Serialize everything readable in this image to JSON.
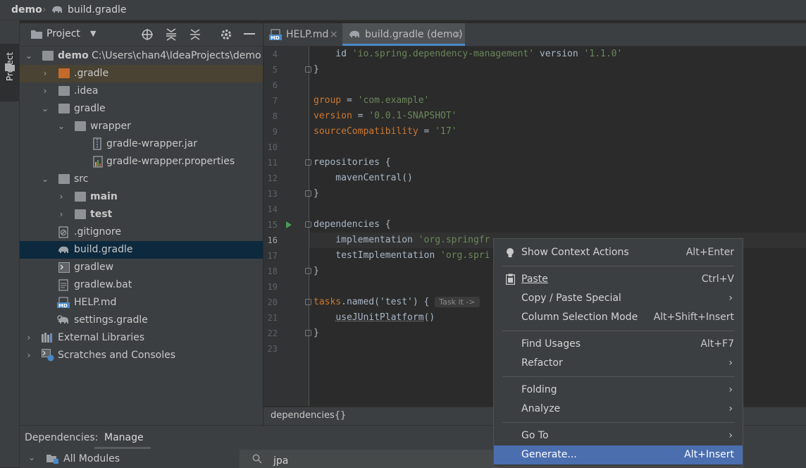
{
  "breadcrumb": {
    "project": "demo",
    "file": "build.gradle"
  },
  "sidebar": {
    "label": "Project"
  },
  "project_panel": {
    "title": "Project",
    "tree": [
      {
        "label": "demo",
        "hint": "C:\\Users\\chan4\\IdeaProjects\\demo",
        "bold": true
      },
      {
        "label": ".gradle"
      },
      {
        "label": ".idea"
      },
      {
        "label": "gradle"
      },
      {
        "label": "wrapper"
      },
      {
        "label": "gradle-wrapper.jar"
      },
      {
        "label": "gradle-wrapper.properties"
      },
      {
        "label": "src"
      },
      {
        "label": "main",
        "bold": true
      },
      {
        "label": "test",
        "bold": true
      },
      {
        "label": ".gitignore"
      },
      {
        "label": "build.gradle",
        "selected": true
      },
      {
        "label": "gradlew"
      },
      {
        "label": "gradlew.bat"
      },
      {
        "label": "HELP.md"
      },
      {
        "label": "settings.gradle"
      },
      {
        "label": "External Libraries"
      },
      {
        "label": "Scratches and Consoles"
      }
    ]
  },
  "editor": {
    "tabs": [
      {
        "label": "HELP.md"
      },
      {
        "label": "build.gradle (demo)",
        "active": true
      }
    ],
    "lines": [
      {
        "n": "4",
        "text": ""
      },
      {
        "n": "5",
        "text": "}"
      },
      {
        "n": "6",
        "text": ""
      },
      {
        "n": "7",
        "text": ""
      },
      {
        "n": "8",
        "text": ""
      },
      {
        "n": "9",
        "text": ""
      },
      {
        "n": "10",
        "text": ""
      },
      {
        "n": "11",
        "text": "repositories {"
      },
      {
        "n": "12",
        "text": "    mavenCentral()"
      },
      {
        "n": "13",
        "text": "}"
      },
      {
        "n": "14",
        "text": ""
      },
      {
        "n": "15",
        "text": "dependencies {"
      },
      {
        "n": "16",
        "text": ""
      },
      {
        "n": "17",
        "text": ""
      },
      {
        "n": "18",
        "text": "}"
      },
      {
        "n": "19",
        "text": ""
      },
      {
        "n": "20",
        "text": ""
      },
      {
        "n": "21",
        "text": ""
      },
      {
        "n": "22",
        "text": "}"
      },
      {
        "n": "23",
        "text": ""
      }
    ],
    "code": {
      "l4_pre": "    id ",
      "l4_str": "'io.spring.dependency-management'",
      "l4_mid": " version ",
      "l4_ver": "'1.1.0'",
      "l7_kw": "group",
      "l7_eq": " = ",
      "l7_str": "'com.example'",
      "l8_kw": "version",
      "l8_eq": " = ",
      "l8_str": "'0.0.1-SNAPSHOT'",
      "l9_kw": "sourceCompatibility",
      "l9_eq": " = ",
      "l9_str": "'17'",
      "l16_pre": "    implementation ",
      "l16_str": "'org.springfr",
      "l17_pre": "    testImplementation ",
      "l17_str": "'org.spri",
      "l20_kw": "tasks",
      "l20_rest": ".named('test') {",
      "l20_hint": "Task it ->",
      "l21_pre": "    ",
      "l21_fn": "useJUnitPlatform",
      "l21_rest": "()"
    },
    "breadcrumb": "dependencies{}"
  },
  "bottom_panel": {
    "tab_label": "Dependencies:",
    "tab_manage": "Manage",
    "modules": "All Modules",
    "search_value": "jpa"
  },
  "context_menu": {
    "items": [
      {
        "label": "Show Context Actions",
        "shortcut": "Alt+Enter"
      },
      {
        "label": "Paste",
        "shortcut": "Ctrl+V"
      },
      {
        "label": "Copy / Paste Special",
        "submenu": true
      },
      {
        "label": "Column Selection Mode",
        "shortcut": "Alt+Shift+Insert"
      },
      {
        "label": "Find Usages",
        "shortcut": "Alt+F7"
      },
      {
        "label": "Refactor",
        "submenu": true
      },
      {
        "label": "Folding",
        "submenu": true
      },
      {
        "label": "Analyze",
        "submenu": true
      },
      {
        "label": "Go To",
        "submenu": true
      },
      {
        "label": "Generate...",
        "shortcut": "Alt+Insert",
        "highlighted": true
      }
    ]
  },
  "colors": {
    "accent": "#4b6eaf",
    "tab_underline": "#4a88c7",
    "string": "#6a8759",
    "keyword": "#cc7832"
  }
}
